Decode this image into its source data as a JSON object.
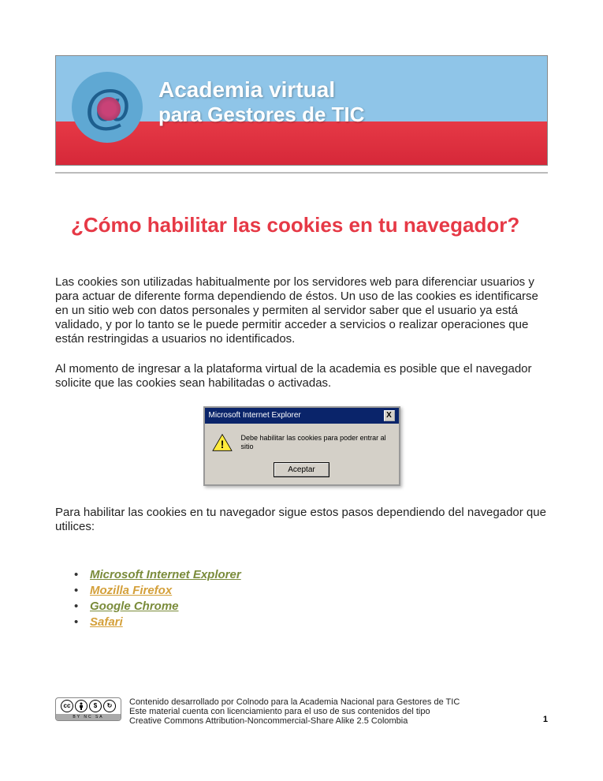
{
  "banner": {
    "line1": "Academia virtual",
    "line2": "para Gestores de TIC"
  },
  "title": "¿Cómo habilitar las cookies en tu navegador?",
  "paragraphs": {
    "p1": "Las cookies son utilizadas habitualmente por los servidores web para diferenciar usuarios y para actuar de diferente forma dependiendo de éstos. Un uso de las cookies es identificarse en un sitio web con datos personales y permiten al servidor saber que el usuario ya está validado, y por lo tanto se le puede permitir acceder a servicios o realizar operaciones que están restringidas a usuarios no identificados.",
    "p2": "Al momento de ingresar a la plataforma virtual de la academia es posible que el navegador solicite que las cookies sean habilitadas o activadas.",
    "p3": "Para habilitar las cookies en tu navegador sigue estos pasos dependiendo del navegador que utilices:"
  },
  "dialog": {
    "title": "Microsoft Internet Explorer",
    "message": "Debe habilitar las cookies para poder entrar al sitio",
    "button": "Aceptar",
    "close": "X"
  },
  "browsers": {
    "b1": "Microsoft Internet Explorer",
    "b2": "Mozilla Firefox",
    "b3": "Google Chrome",
    "b4": "Safari"
  },
  "footer": {
    "line1": "Contenido desarrollado por Colnodo para la Academia Nacional para Gestores de TIC",
    "line2": "Este material cuenta con licenciamiento para el uso de sus contenidos del tipo",
    "line3": "Creative Commons Attribution-Noncommercial-Share Alike 2.5 Colombia",
    "cc_label": "BY NC SA"
  },
  "page_number": "1"
}
